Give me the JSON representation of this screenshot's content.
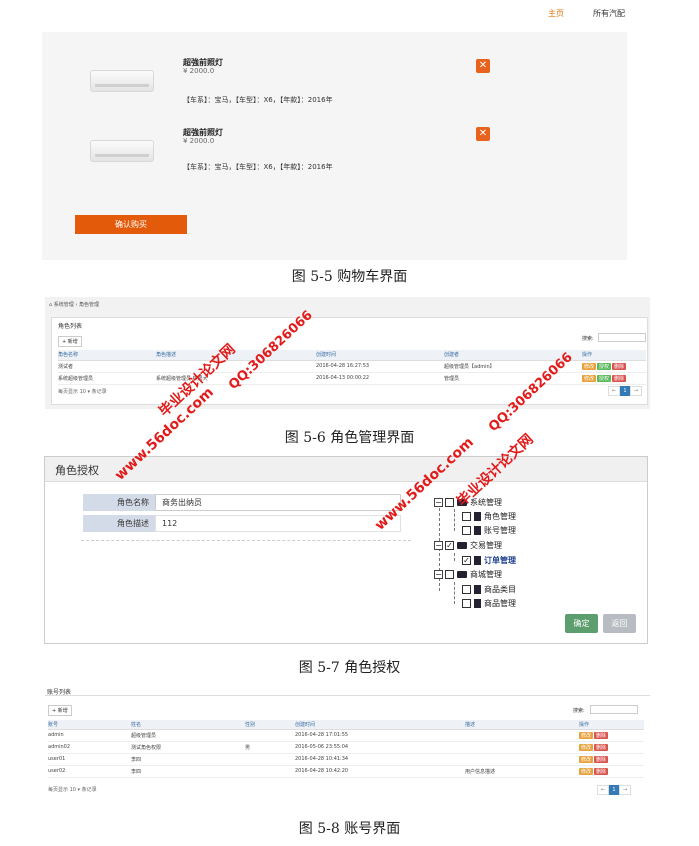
{
  "fig55": {
    "nav_home": "主页",
    "nav_all": "所有汽配",
    "items": [
      {
        "name": "超強前照灯",
        "price": "¥ 2000.0",
        "specs": "【车系】：宝马，【车型】：X6，【年款】：2016年"
      },
      {
        "name": "超強前照灯",
        "price": "¥ 2000.0",
        "specs": "【车系】：宝马，【车型】：X6，【年款】：2016年"
      }
    ],
    "buy_label": "确认购买",
    "caption": "图 5-5 购物车界面"
  },
  "fig56": {
    "breadcrumb": "系统管理 › 角色管理",
    "panel_title": "角色列表",
    "add_label": "+ 新增",
    "search_label": "搜索:",
    "columns": [
      "角色名称",
      "角色描述",
      "创建时间",
      "创建者",
      "操作"
    ],
    "rows": [
      {
        "name": "测试者",
        "desc": "",
        "time": "2016-04-28 16:27:53",
        "creator": "超级管理员【admin】"
      },
      {
        "name": "系统超级管理员",
        "desc": "系统超级管理员 权限大",
        "time": "2016-04-13 00:00:22",
        "creator": "管理员"
      }
    ],
    "actions": [
      "修改",
      "授权",
      "删除"
    ],
    "footer": "每页显示 10 ▾ 条记录",
    "pager": [
      "←",
      "1",
      "→"
    ],
    "caption": "图 5-6 角色管理界面"
  },
  "fig57": {
    "title": "角色授权",
    "label_name": "角色名称",
    "value_name": "商务出纳员",
    "label_desc": "角色描述",
    "value_desc": "112",
    "tree": {
      "g1": "系统管理",
      "g1_items": [
        "角色管理",
        "账号管理"
      ],
      "g2": "交易管理",
      "g2_items": [
        "订单管理"
      ],
      "g3": "商城管理",
      "g3_items": [
        "商品类目",
        "商品管理"
      ]
    },
    "confirm_label": "确定",
    "back_label": "返回",
    "caption": "图 5-7 角色授权"
  },
  "fig58": {
    "panel_title": "账号列表",
    "add_label": "+ 新增",
    "search_label": "搜索:",
    "columns": [
      "账号",
      "姓名",
      "性别",
      "创建时间",
      "描述",
      "操作"
    ],
    "rows": [
      {
        "acct": "admin",
        "name": "超级管理员",
        "sex": "",
        "time": "2016-04-28 17:01:55",
        "desc": ""
      },
      {
        "acct": "admin02",
        "name": "测试角色权限",
        "sex": "男",
        "time": "2016-05-06 23:55:04",
        "desc": ""
      },
      {
        "acct": "user01",
        "name": "李四",
        "sex": "",
        "time": "2016-04-28 10:41:34",
        "desc": ""
      },
      {
        "acct": "user02",
        "name": "李四",
        "sex": "",
        "time": "2016-04-28 10:42:20",
        "desc": "用户信息描述"
      }
    ],
    "actions": [
      "修改",
      "删除"
    ],
    "footer": "每页显示 10 ▾ 条记录",
    "pager": [
      "←",
      "1",
      "→"
    ],
    "caption": "图 5-8 账号界面"
  },
  "watermarks": {
    "site": "www.56doc.com",
    "name": "毕业设计论文网",
    "qq": "QQ:306826066"
  },
  "colors": {
    "accent_orange": "#e35a0b",
    "watermark_red": "#e21b1b",
    "link_blue": "#3a6ea5"
  }
}
